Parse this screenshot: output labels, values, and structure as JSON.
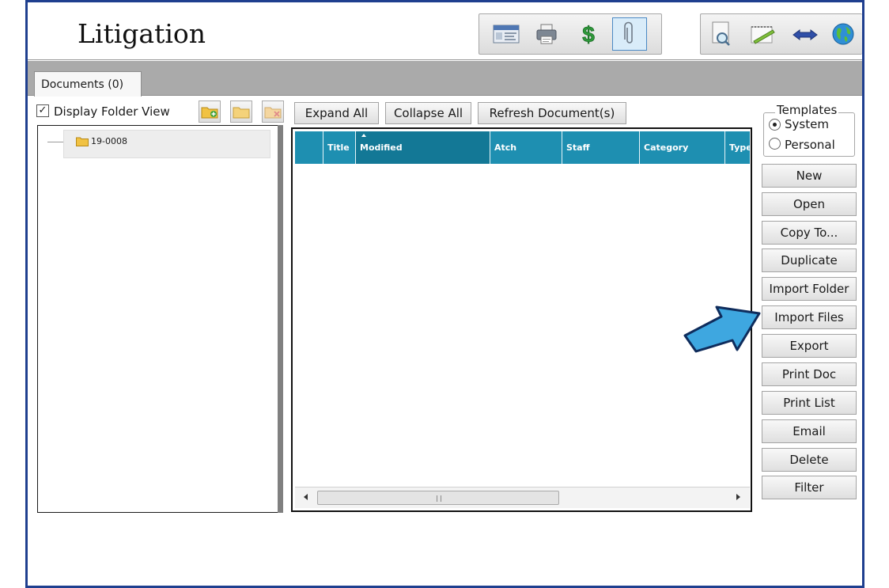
{
  "app": {
    "title": "Litigation"
  },
  "toolbar": {
    "group1": [
      {
        "icon": "contact-card-icon"
      },
      {
        "icon": "printer-icon"
      },
      {
        "icon": "dollar-sign-icon"
      },
      {
        "icon": "paperclip-icon",
        "active": true
      }
    ],
    "group2": [
      {
        "icon": "document-search-icon"
      },
      {
        "icon": "notepad-pencil-icon"
      },
      {
        "icon": "swap-arrows-icon"
      },
      {
        "icon": "globe-icon"
      }
    ]
  },
  "tabs": [
    {
      "label": "Documents (0)",
      "active": true
    }
  ],
  "actions": {
    "display_folder_view": "Display Folder View",
    "display_folder_view_checked": true,
    "expand_all": "Expand All",
    "collapse_all": "Collapse All",
    "refresh": "Refresh Document(s)"
  },
  "tree": {
    "root": {
      "label": "19-0008"
    }
  },
  "grid": {
    "columns": [
      "",
      "Title",
      "Modified",
      "Atch",
      "Staff",
      "Category",
      "Type"
    ],
    "sorted_column": "Modified",
    "rows": []
  },
  "templates": {
    "legend": "Templates",
    "options": [
      {
        "label": "System",
        "checked": true
      },
      {
        "label": "Personal",
        "checked": false
      }
    ]
  },
  "side_buttons": [
    "New",
    "Open",
    "Copy To...",
    "Duplicate",
    "Import Folder",
    "Import Files",
    "Export",
    "Print Doc",
    "Print List",
    "Email",
    "Delete",
    "Filter"
  ],
  "annotation": {
    "pointer_target": "Import Files",
    "color": "#3ea7e0"
  },
  "colors": {
    "frame": "#1f3f8f",
    "grid_header": "#1e8fb1",
    "tab_strip": "#aaaaaa"
  }
}
